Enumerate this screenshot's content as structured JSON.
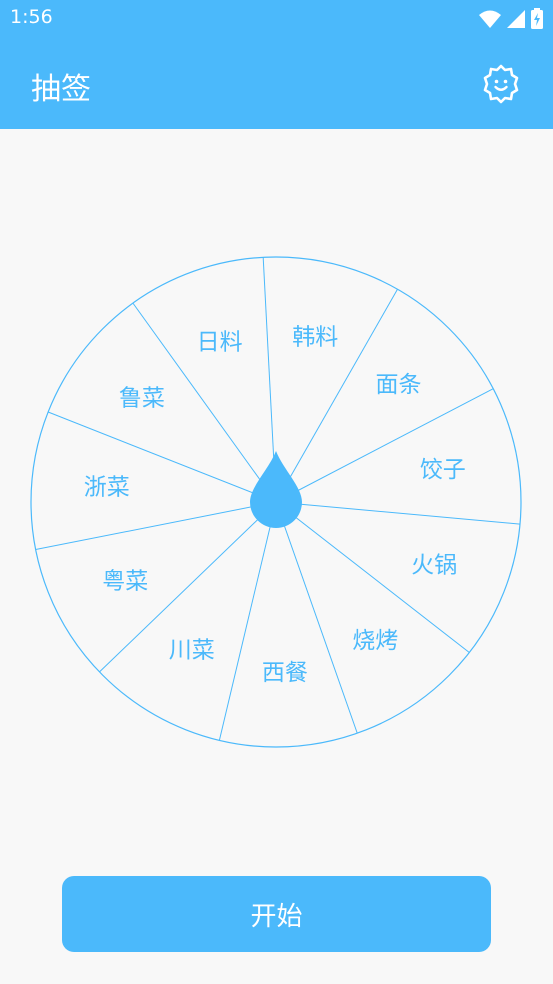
{
  "status": {
    "time": "1:56"
  },
  "header": {
    "title": "抽签",
    "settings_icon": "settings-gear-smile-icon"
  },
  "wheel": {
    "items": [
      "日料",
      "韩料",
      "面条",
      "饺子",
      "火锅",
      "烧烤",
      "西餐",
      "川菜",
      "粤菜",
      "浙菜",
      "鲁菜"
    ],
    "pointer_icon": "water-drop-pointer-icon"
  },
  "actions": {
    "start_label": "开始"
  },
  "colors": {
    "primary": "#4bb9fb",
    "background": "#f8f8f8",
    "text": "#ffffff"
  }
}
